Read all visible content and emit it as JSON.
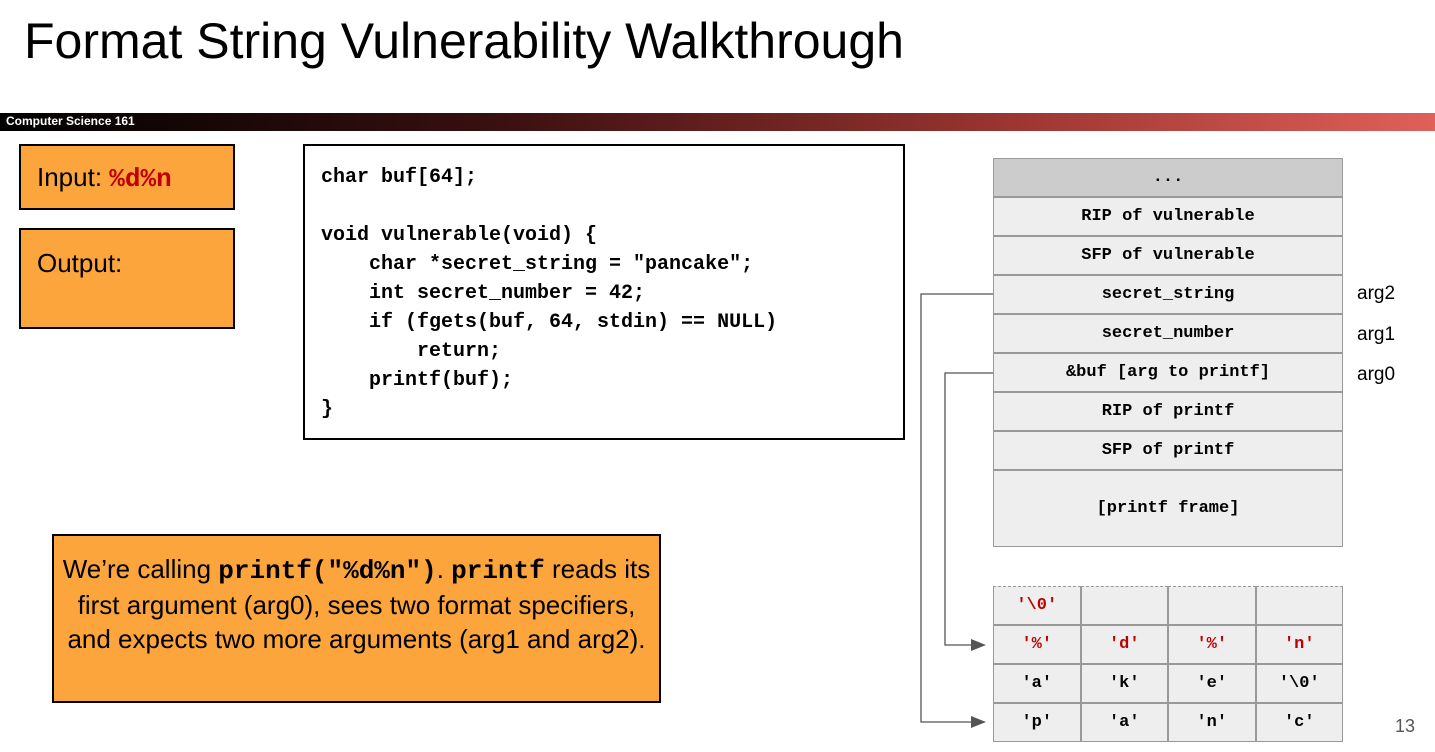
{
  "slide": {
    "title": "Format String Vulnerability Walkthrough",
    "course": "Computer Science 161",
    "page_number": "13"
  },
  "io": {
    "input_label": "Input: ",
    "input_value": "%d%n",
    "output_label": "Output:"
  },
  "code": {
    "lines": [
      "char buf[64];",
      "",
      "void vulnerable(void) {",
      "    char *secret_string = \"pancake\";",
      "    int secret_number = 42;",
      "    if (fgets(buf, 64, stdin) == NULL)",
      "        return;",
      "    printf(buf);",
      "}"
    ]
  },
  "stack": {
    "cells": [
      "...",
      "RIP of vulnerable",
      "SFP of vulnerable",
      "secret_string",
      "secret_number",
      "&buf [arg to printf]",
      "RIP of printf",
      "SFP of printf",
      "[printf frame]"
    ],
    "arg_labels": [
      "arg2",
      "arg1",
      "arg0"
    ]
  },
  "buffer": {
    "rows": [
      [
        "'\\0'",
        "",
        "",
        ""
      ],
      [
        "'%'",
        "'d'",
        "'%'",
        "'n'"
      ],
      [
        "'a'",
        "'k'",
        "'e'",
        "'\\0'"
      ],
      [
        "'p'",
        "'a'",
        "'n'",
        "'c'"
      ]
    ]
  },
  "note": {
    "text1": "We’re calling ",
    "code1": "printf(\"%d%n\")",
    "text2": ". ",
    "code2": "printf",
    "text3": " reads its first argument (arg0), sees two format specifiers, and expects two more arguments (arg1 and arg2)."
  },
  "colors": {
    "accent_orange": "#fba53c",
    "highlight_red": "#c00000",
    "cell_gray": "#eeeeee"
  }
}
